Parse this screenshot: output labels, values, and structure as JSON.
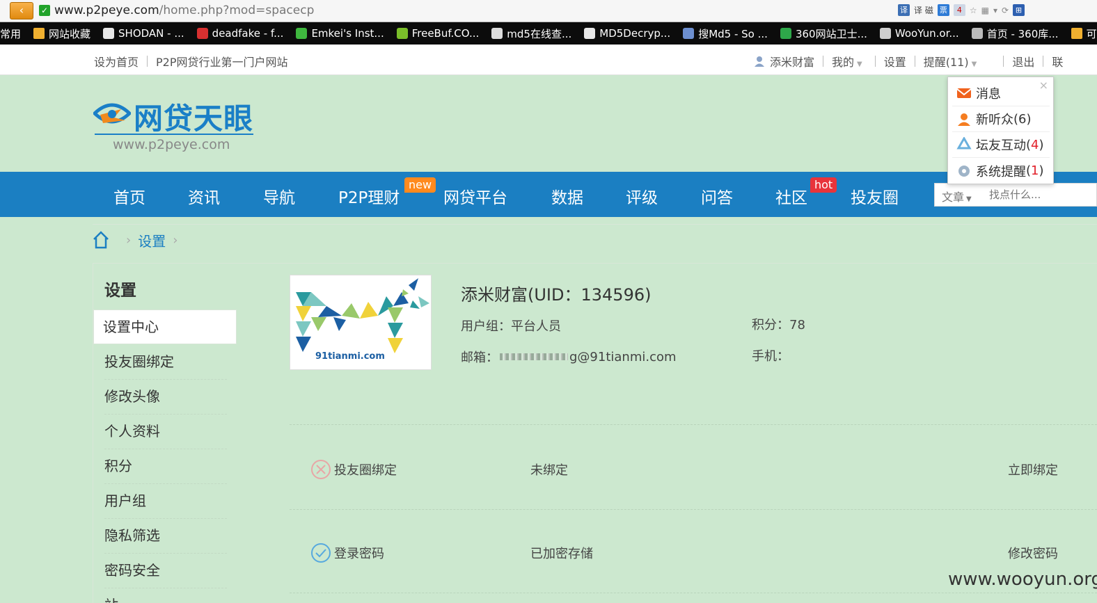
{
  "browser": {
    "url_main": "www.p2peye.com",
    "url_rest": "/home.php?mod=spacecp",
    "back_icon": "back-arrow-icon",
    "toolbar_text": "译 磁",
    "toolbar_badge": "4"
  },
  "bookmarks": [
    {
      "label": "常用",
      "icon": "folder-icon"
    },
    {
      "label": "网站收藏",
      "icon": "folder-icon"
    },
    {
      "label": "SHODAN - ...",
      "icon": "page-icon"
    },
    {
      "label": "deadfake - f...",
      "icon": "bar-icon"
    },
    {
      "label": "Emkei's Inst...",
      "icon": "arrow-icon"
    },
    {
      "label": "FreeBuf.CO...",
      "icon": "f-icon"
    },
    {
      "label": "md5在线查...",
      "icon": "grid-icon"
    },
    {
      "label": "MD5Decryp...",
      "icon": "page-icon"
    },
    {
      "label": "搜Md5 - So ...",
      "icon": "news-icon"
    },
    {
      "label": "360网站卫士...",
      "icon": "shield-icon"
    },
    {
      "label": "WooYun.or...",
      "icon": "cloud-icon"
    },
    {
      "label": "首页 - 360库...",
      "icon": "star-icon"
    },
    {
      "label": "可提交",
      "icon": "folder-icon"
    }
  ],
  "sitebar": {
    "set_home": "设为首页",
    "slogan": "P2P网贷行业第一门户网站",
    "username": "添米财富",
    "mine": "我的",
    "settings": "设置",
    "reminders": "提醒(11)",
    "logout": "退出",
    "contact": "联"
  },
  "logo": {
    "name": "网贷天眼",
    "domain": "www.p2peye.com"
  },
  "nav": {
    "items": [
      "首页",
      "资讯",
      "导航",
      "P2P理财",
      "网贷平台",
      "数据",
      "评级",
      "问答",
      "社区",
      "投友圈"
    ],
    "new_badge": "new",
    "hot_badge": "hot",
    "search_type": "文章",
    "search_placeholder": "找点什么..."
  },
  "dropdown": {
    "messages": "消息",
    "followers_label": "新听众",
    "followers_count": "(6)",
    "forum_label": "坛友互动",
    "forum_count_open": "(",
    "forum_count": "4",
    "forum_count_close": ")",
    "system_label": "系统提醒",
    "system_count": "1"
  },
  "breadcrumb": {
    "current": "设置"
  },
  "sidebar": {
    "title": "设置",
    "items": [
      "设置中心",
      "投友圈绑定",
      "修改头像",
      "个人资料",
      "积分",
      "用户组",
      "隐私筛选",
      "密码安全",
      "站..."
    ]
  },
  "profile": {
    "name_uid": "添米财富(UID：134596)",
    "group_label": "用户组：平台人员",
    "points_label": "积分：78",
    "email_label": "邮箱：",
    "email_value": "g@91tianmi.com",
    "phone_label": "手机：",
    "avatar_text": "91tianmi.com"
  },
  "security": [
    {
      "label": "投友圈绑定",
      "status": "未绑定",
      "action": "立即绑定",
      "icon": "cross-circle-icon"
    },
    {
      "label": "登录密码",
      "status": "已加密存储",
      "action": "修改密码",
      "icon": "check-circle-icon"
    }
  ],
  "watermark": "www.wooyun.org"
}
